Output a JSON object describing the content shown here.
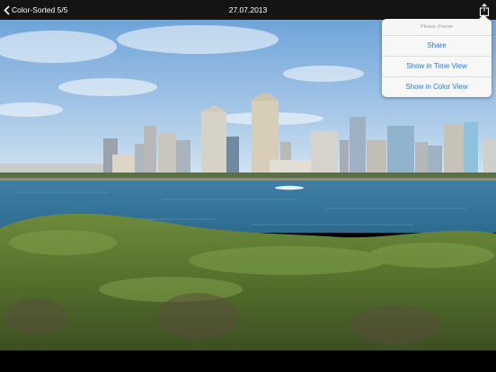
{
  "navbar": {
    "back_label": "Color-Sorted 5/5",
    "title": "27.07.2013"
  },
  "icons": {
    "back": "chevron-left-icon",
    "share": "share-icon"
  },
  "popover": {
    "header": "Please choose",
    "items": [
      {
        "label": "Share"
      },
      {
        "label": "Show in Time View"
      },
      {
        "label": "Show in Color View"
      }
    ]
  },
  "colors": {
    "navbar_bg": "#141414",
    "accent": "#1f7bf2",
    "popover_bg": "#f7f7f7"
  }
}
